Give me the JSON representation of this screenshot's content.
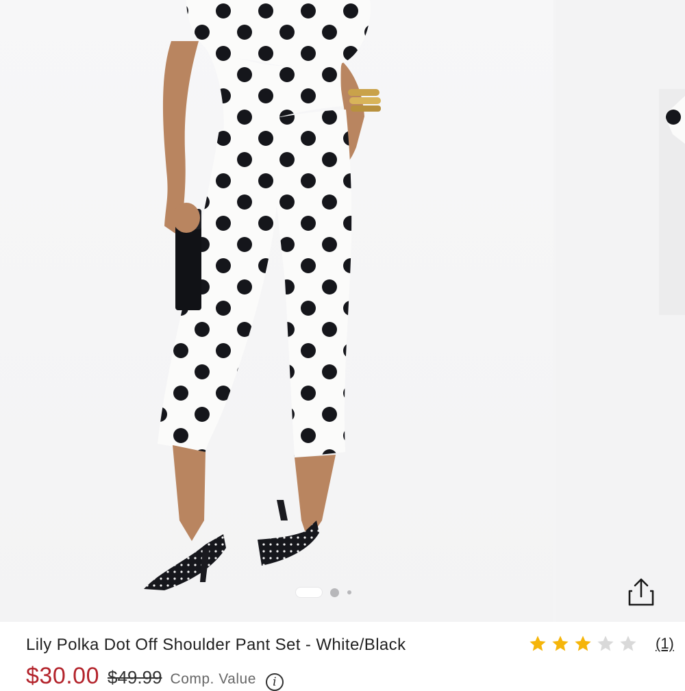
{
  "product": {
    "title": "Lily Polka Dot Off Shoulder Pant Set - White/Black",
    "price_sale": "$30.00",
    "price_original": "$49.99",
    "comp_value_label": "Comp. Value",
    "info_icon_glyph": "i",
    "rating": {
      "stars_filled": 3,
      "stars_total": 5,
      "review_count_label": "(1)"
    }
  },
  "gallery": {
    "image_count_indicator": 3,
    "active_index": 0
  },
  "colors": {
    "sale_price": "#b3232b",
    "star_filled": "#f5b50a",
    "star_empty": "#d9d9d9",
    "background": "#f4f4f5"
  },
  "icons": {
    "share": "share-icon",
    "info": "info-icon",
    "star": "star-icon"
  }
}
